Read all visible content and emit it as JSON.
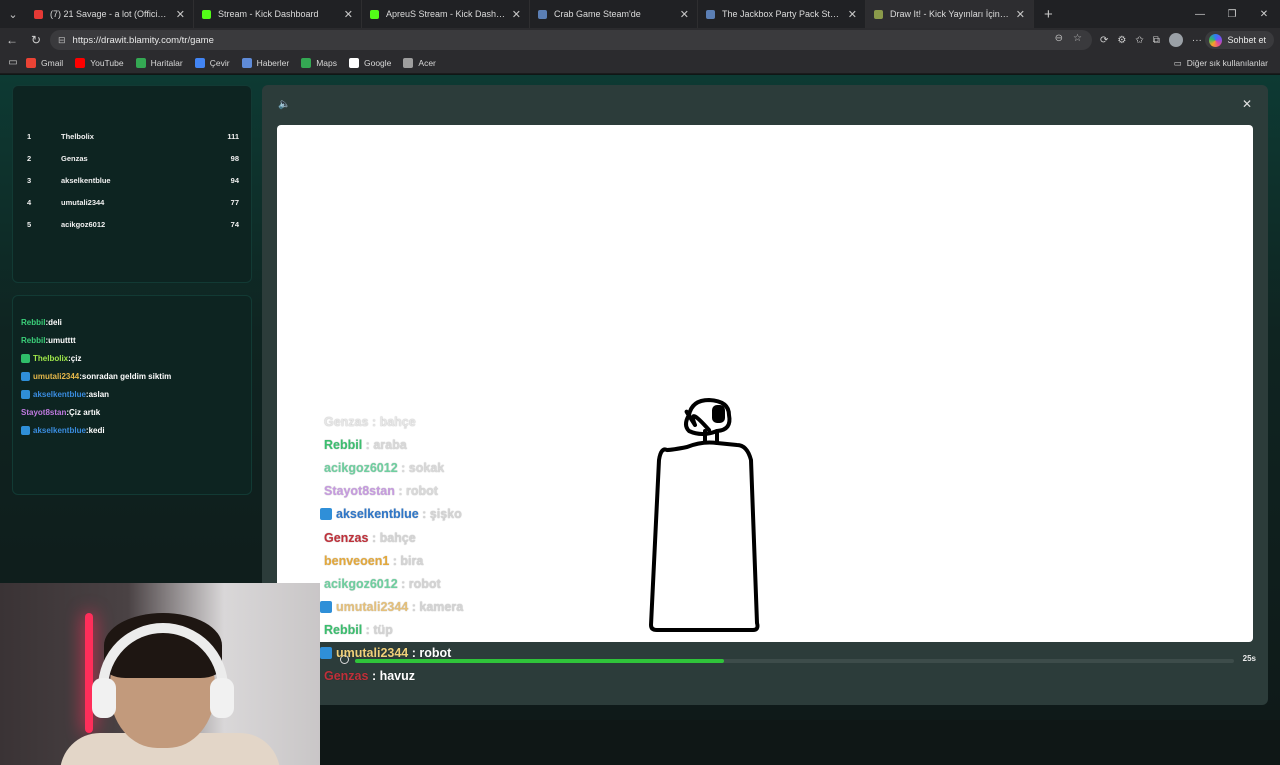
{
  "browser": {
    "tabs": [
      {
        "title": "(7) 21 Savage - a lot (Official Video)",
        "color": "#e53935",
        "active": false
      },
      {
        "title": "Stream - Kick Dashboard",
        "color": "#53fc18",
        "active": false
      },
      {
        "title": "ApreuS Stream - Kick Dashboard",
        "color": "#53fc18",
        "active": false
      },
      {
        "title": "Crab Game Steam'de",
        "color": "#5b7fb5",
        "active": false
      },
      {
        "title": "The Jackbox Party Pack Steam'de",
        "color": "#5b7fb5",
        "active": false
      },
      {
        "title": "Draw It! - Kick Yayınları İçin Çizim",
        "color": "#8a9a4a",
        "active": true
      }
    ],
    "url": "https://drawit.blamity.com/tr/game",
    "chat_button": "Sohbet et",
    "bookmarks": [
      {
        "label": "Gmail",
        "color": "#ea4335"
      },
      {
        "label": "YouTube",
        "color": "#ff0000"
      },
      {
        "label": "Haritalar",
        "color": "#34a853"
      },
      {
        "label": "Çevir",
        "color": "#4285f4"
      },
      {
        "label": "Haberler",
        "color": "#5f8bd8"
      },
      {
        "label": "Maps",
        "color": "#34a853"
      },
      {
        "label": "Google",
        "color": "#ffffff"
      },
      {
        "label": "Acer",
        "color": "#9e9e9e"
      }
    ],
    "other_bookmarks": "Diğer sık kullanılanlar"
  },
  "leaderboard": [
    {
      "rank": "1",
      "name": "Thelbolix",
      "score": "111"
    },
    {
      "rank": "2",
      "name": "Genzas",
      "score": "98"
    },
    {
      "rank": "3",
      "name": "akselkentblue",
      "score": "94"
    },
    {
      "rank": "4",
      "name": "umutali2344",
      "score": "77"
    },
    {
      "rank": "5",
      "name": "acikgoz6012",
      "score": "74"
    }
  ],
  "chat": [
    {
      "user": "Rebbil",
      "text": "deli",
      "color": "#3bd17a",
      "badge": ""
    },
    {
      "user": "Rebbil",
      "text": "umutttt",
      "color": "#3bd17a",
      "badge": ""
    },
    {
      "user": "Thelbolix",
      "text": "çiz",
      "color": "#9fe84a",
      "badge": "#2fbf6a"
    },
    {
      "user": "umutali2344",
      "text": "sonradan geldim siktim",
      "color": "#e6b84a",
      "badge": "#2f8fd8"
    },
    {
      "user": "akselkentblue",
      "text": "aslan",
      "color": "#3a8de0",
      "badge": "#2f8fd8"
    },
    {
      "user": "Stayot8stan",
      "text": "Çiz artık",
      "color": "#c07ae0",
      "badge": ""
    },
    {
      "user": "akselkentblue",
      "text": "kedi",
      "color": "#3a8de0",
      "badge": "#2f8fd8"
    }
  ],
  "game": {
    "timer_label": "25s",
    "timer_progress": 0.42
  },
  "guesses": [
    {
      "user": "Genzas",
      "word": "bahçe",
      "color": "#e7e7e7",
      "word_color": "#e7e7e7",
      "badge": false
    },
    {
      "user": "Rebbil",
      "word": "araba",
      "color": "#3bbf6f",
      "word_color": "#d9d9d9",
      "badge": false
    },
    {
      "user": "acikgoz6012",
      "word": "sokak",
      "color": "#6fd0a0",
      "word_color": "#d9d9d9",
      "badge": false
    },
    {
      "user": "Stayot8stan",
      "word": "robot",
      "color": "#c79be0",
      "word_color": "#d9d9d9",
      "badge": false
    },
    {
      "user": "akselkentblue",
      "word": "şişko",
      "color": "#2f77c9",
      "word_color": "#d4d4d4",
      "badge": true
    },
    {
      "user": "Genzas",
      "word": "bahçe",
      "color": "#c0303a",
      "word_color": "#d4d4d4",
      "badge": false
    },
    {
      "user": "benveoen1",
      "word": "bira",
      "color": "#e5a93a",
      "word_color": "#d4d4d4",
      "badge": false
    },
    {
      "user": "acikgoz6012",
      "word": "robot",
      "color": "#6fd0a0",
      "word_color": "#d4d4d4",
      "badge": false
    },
    {
      "user": "umutali2344",
      "word": "kamera",
      "color": "#e5c07a",
      "word_color": "#d4d4d4",
      "badge": true
    },
    {
      "user": "Rebbil",
      "word": "tüp",
      "color": "#3bbf6f",
      "word_color": "#d4d4d4",
      "badge": false
    },
    {
      "user": "umutali2344",
      "word": "robot",
      "color": "#f0d07a",
      "word_color": "#ffffff",
      "badge": true
    },
    {
      "user": "Genzas",
      "word": "havuz",
      "color": "#c0303a",
      "word_color": "#ffffff",
      "badge": false
    }
  ]
}
